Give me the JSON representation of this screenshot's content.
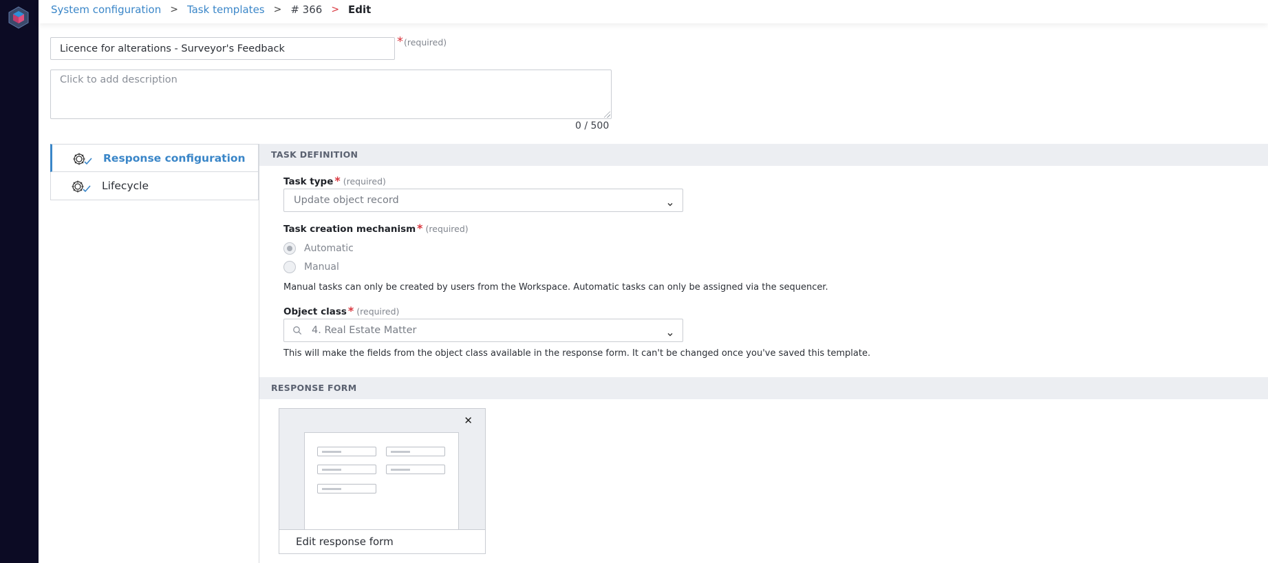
{
  "breadcrumb": {
    "items": [
      {
        "label": "System configuration"
      },
      {
        "label": "Task templates"
      },
      {
        "label": "# 366"
      },
      {
        "label": "Edit"
      }
    ]
  },
  "template": {
    "title_value": "Licence for alterations - Surveyor's Feedback",
    "required_star": "*",
    "required_label": "(required)",
    "description_placeholder": "Click to add description",
    "char_count": "0 / 500"
  },
  "tabs": [
    {
      "label": "Response configuration",
      "active": true
    },
    {
      "label": "Lifecycle",
      "active": false
    }
  ],
  "task_definition": {
    "heading": "TASK DEFINITION",
    "task_type": {
      "label": "Task type",
      "star": "*",
      "required": "(required)",
      "value": "Update object record"
    },
    "creation_mechanism": {
      "label": "Task creation mechanism",
      "star": "*",
      "required": "(required)",
      "options": [
        {
          "label": "Automatic",
          "selected": true
        },
        {
          "label": "Manual",
          "selected": false
        }
      ],
      "help": "Manual tasks can only be created by users from the Workspace. Automatic tasks can only be assigned via the sequencer."
    },
    "object_class": {
      "label": "Object class",
      "star": "*",
      "required": "(required)",
      "value": "4. Real Estate Matter",
      "help": "This will make the fields from the object class available in the response form. It can't be changed once you've saved this template."
    }
  },
  "response_form": {
    "heading": "RESPONSE FORM",
    "close_glyph": "✕",
    "edit_label": "Edit response form"
  },
  "colors": {
    "sidebar": "#0c0b24",
    "accent": "#3a86c8",
    "required": "#d9363e",
    "section_bg": "#eceef2"
  },
  "icons": [
    "app-logo-icon",
    "chevron-right-icon",
    "gear-check-icon",
    "chevron-down-icon",
    "search-icon",
    "close-icon"
  ]
}
